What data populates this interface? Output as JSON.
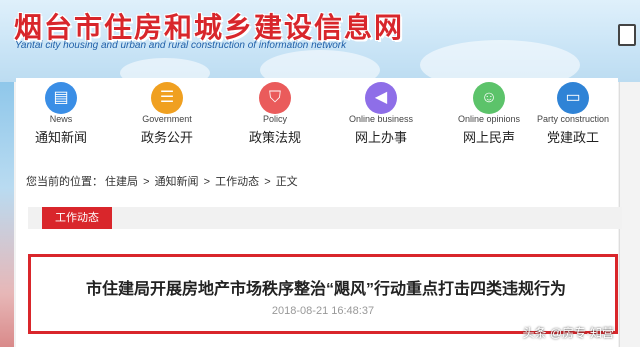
{
  "header": {
    "site_title": "烟台市住房和城乡建设信息网",
    "site_subtitle": "Yantai city housing and urban and rural construction of information network"
  },
  "nav": {
    "items": [
      {
        "en": "News",
        "cn": "通知新闻",
        "icon": "news-icon",
        "color": "#3a8ee6"
      },
      {
        "en": "Government",
        "cn": "政务公开",
        "icon": "list-icon",
        "color": "#f0a020"
      },
      {
        "en": "Policy",
        "cn": "政策法规",
        "icon": "shield-icon",
        "color": "#ea5b5b"
      },
      {
        "en": "Online business",
        "cn": "网上办事",
        "icon": "megaphone-icon",
        "color": "#8e6ee8"
      },
      {
        "en": "Online opinions",
        "cn": "网上民声",
        "icon": "people-icon",
        "color": "#5cc36a"
      },
      {
        "en": "Party construction",
        "cn": "党建政工",
        "icon": "monitor-icon",
        "color": "#2f83d6"
      }
    ]
  },
  "breadcrumb": {
    "prefix": "您当前的位置：",
    "items": [
      "住建局",
      "通知新闻",
      "工作动态",
      "正文"
    ],
    "sep": ">"
  },
  "category": {
    "label": "工作动态"
  },
  "article": {
    "title": "市住建局开展房地产市场秩序整治“飓风”行动重点打击四类违规行为",
    "date": "2018-08-21 16:48:37"
  },
  "watermark": "头条 @房专·知营"
}
